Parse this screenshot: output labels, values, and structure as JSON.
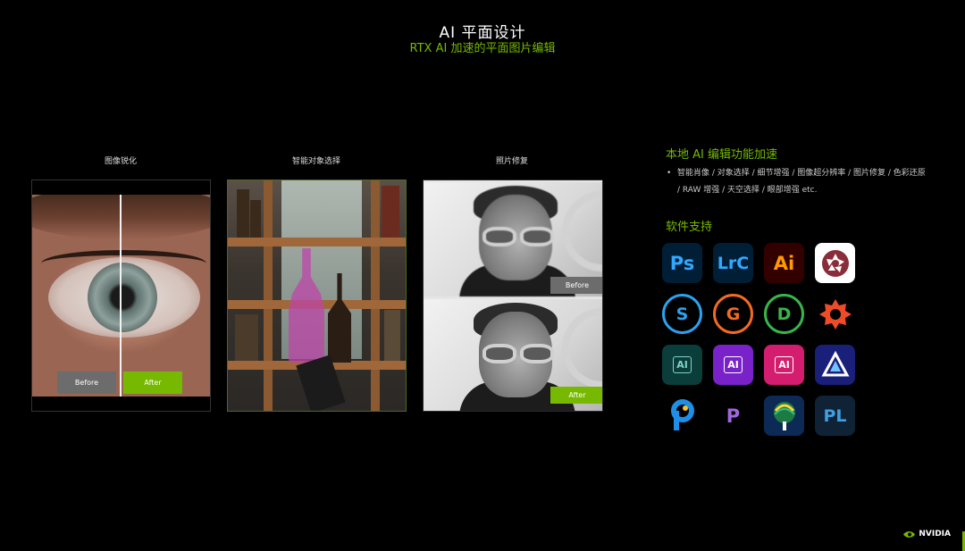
{
  "header": {
    "title": "AI 平面设计",
    "subtitle": "RTX AI 加速的平面图片编辑"
  },
  "panels": {
    "sharpen": {
      "label": "图像锐化",
      "before": "Before",
      "after": "After"
    },
    "select": {
      "label": "智能对象选择"
    },
    "restore": {
      "label": "照片修复",
      "before": "Before",
      "after": "After"
    }
  },
  "features": {
    "heading": "本地 AI 编辑功能加速",
    "bullet": "智能肖像 / 对象选择 / 细节增强 / 图像超分辨率 / 图片修复 / 色彩还原 / RAW 增强 / 天空选择 / 眼部增强 etc."
  },
  "software": {
    "heading": "软件支持",
    "icons": [
      {
        "label": "Ps",
        "icon": "photoshop-icon",
        "bg": "#001e36",
        "fg": "#31a8ff"
      },
      {
        "label": "LrC",
        "icon": "lightroom-classic-icon",
        "bg": "#001e36",
        "fg": "#31a8ff"
      },
      {
        "label": "Ai",
        "icon": "illustrator-icon",
        "bg": "#330000",
        "fg": "#ff9a00"
      },
      {
        "label": "",
        "icon": "aperture-icon",
        "bg": "#ffffff",
        "fg": "#8a2d3a"
      },
      {
        "label": "S",
        "icon": "topaz-sharpen-icon",
        "bg": "#000000",
        "fg": "#2aa3ef"
      },
      {
        "label": "G",
        "icon": "topaz-gigapixel-icon",
        "bg": "#000000",
        "fg": "#f36b21"
      },
      {
        "label": "D",
        "icon": "topaz-denoise-icon",
        "bg": "#000000",
        "fg": "#38b54a"
      },
      {
        "label": "",
        "icon": "topaz-photo-ai-icon",
        "bg": "#000000",
        "fg": "#ee4b28"
      },
      {
        "label": "AI",
        "icon": "ai-image-enhancer-icon",
        "bg": "#0b3d3a",
        "fg": "#7fd3c9"
      },
      {
        "label": "AI",
        "icon": "ai-upscaler-icon",
        "bg": "#7a22c9",
        "fg": "#ffffff"
      },
      {
        "label": "AI",
        "icon": "ai-portrait-icon",
        "bg": "#d41d6f",
        "fg": "#ffffff"
      },
      {
        "label": "",
        "icon": "luminar-icon",
        "bg": "#1a1f7a",
        "fg": "#ffffff"
      },
      {
        "label": "",
        "icon": "corel-paintshop-icon",
        "bg": "#000000",
        "fg": "#1e8ee6"
      },
      {
        "label": "P",
        "icon": "corel-painter-icon",
        "bg": "#000000",
        "fg": "#a066e0"
      },
      {
        "label": "",
        "icon": "coreldraw-icon",
        "bg": "#0c2a55",
        "fg": "#33c27f"
      },
      {
        "label": "PL",
        "icon": "dxo-photolab-icon",
        "bg": "#0f2236",
        "fg": "#3f9fe0"
      }
    ]
  },
  "brand": {
    "name": "NVIDIA",
    "accent": "#76b900"
  }
}
